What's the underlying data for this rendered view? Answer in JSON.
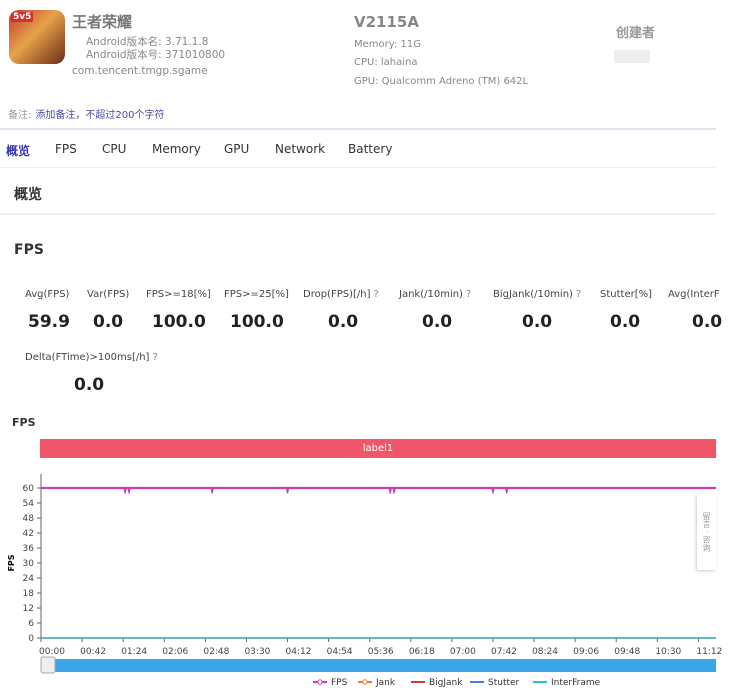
{
  "app": {
    "name": "王者荣耀",
    "version_name": "Android版本名: 3.71.1.8",
    "version_code": "Android版本号: 371010800",
    "package": "com.tencent.tmgp.sgame",
    "icon_badge": "5v5"
  },
  "device": {
    "model": "V2115A",
    "memory": "Memory: 11G",
    "cpu": "CPU: lahaina",
    "gpu": "GPU: Qualcomm Adreno (TM) 642L"
  },
  "creator": {
    "label": "创建者"
  },
  "note": {
    "label": "备注:",
    "link": "添加备注，不超过200个字符"
  },
  "tabs": [
    {
      "label": "概览",
      "active": true
    },
    {
      "label": "FPS"
    },
    {
      "label": "CPU"
    },
    {
      "label": "Memory"
    },
    {
      "label": "GPU"
    },
    {
      "label": "Network"
    },
    {
      "label": "Battery"
    }
  ],
  "overview_title": "概览",
  "fps_section": {
    "title": "FPS",
    "metrics": [
      {
        "label": "Avg(FPS)",
        "value": "59.9"
      },
      {
        "label": "Var(FPS)",
        "value": "0.0"
      },
      {
        "label": "FPS>=18[%]",
        "value": "100.0"
      },
      {
        "label": "FPS>=25[%]",
        "value": "100.0"
      },
      {
        "label": "Drop(FPS)[/h]",
        "value": "0.0",
        "help": "?"
      },
      {
        "label": "Jank(/10min)",
        "value": "0.0",
        "help": "?"
      },
      {
        "label": "BigJank(/10min)",
        "value": "0.0",
        "help": "?"
      },
      {
        "label": "Stutter[%]",
        "value": "0.0"
      },
      {
        "label": "Avg(InterF",
        "value": "0.0"
      },
      {
        "label": "Delta(FTime)>100ms[/h]",
        "value": "0.0",
        "help": "?"
      }
    ]
  },
  "side_tab": "留言 · 咨询",
  "chart_data": {
    "type": "line",
    "title": "FPS",
    "ylabel": "FPS",
    "band_label": "label1",
    "ylim": [
      0,
      60
    ],
    "yticks": [
      "0",
      "6",
      "12",
      "18",
      "24",
      "30",
      "36",
      "42",
      "48",
      "54",
      "60"
    ],
    "xticks": [
      "00:00",
      "00:42",
      "01:24",
      "02:06",
      "02:48",
      "03:30",
      "04:12",
      "04:54",
      "05:36",
      "06:18",
      "07:00",
      "07:42",
      "08:24",
      "09:06",
      "09:48",
      "10:30",
      "11:12"
    ],
    "xlim_seconds": [
      0,
      690
    ],
    "series": [
      {
        "name": "FPS",
        "color": "#c23fb5",
        "baseline": 60,
        "dips": [
          {
            "t": "01:26",
            "v": 58.6
          },
          {
            "t": "01:30",
            "v": 58.6
          },
          {
            "t": "02:55",
            "v": 58.6
          },
          {
            "t": "04:12",
            "v": 58.6
          },
          {
            "t": "05:57",
            "v": 58.6
          },
          {
            "t": "06:01",
            "v": 58.6
          },
          {
            "t": "07:42",
            "v": 58.6
          },
          {
            "t": "07:56",
            "v": 58.6
          }
        ]
      },
      {
        "name": "Jank",
        "color": "#f07a32",
        "baseline": 0
      },
      {
        "name": "BigJank",
        "color": "#d43b3b",
        "baseline": 0
      },
      {
        "name": "Stutter",
        "color": "#4c7ce6",
        "baseline": 0
      },
      {
        "name": "InterFrame",
        "color": "#2bc0d0",
        "baseline": 0
      }
    ],
    "grid": false,
    "legend": "bottom"
  }
}
